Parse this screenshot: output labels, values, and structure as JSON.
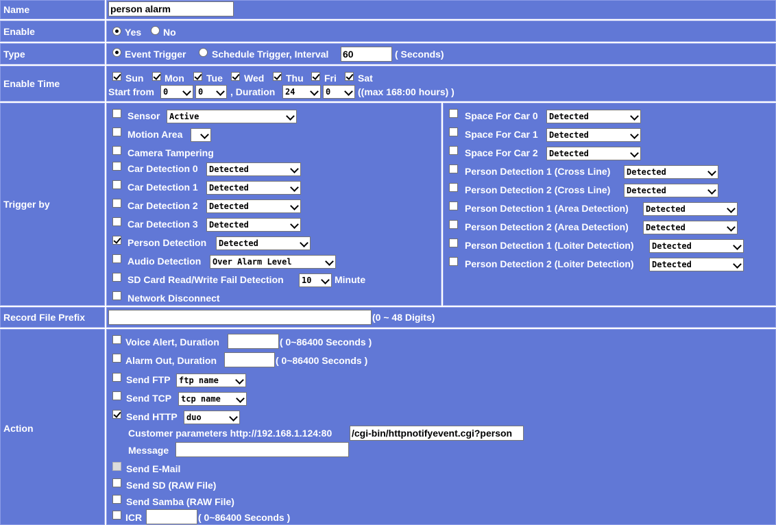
{
  "rows": {
    "name": {
      "label": "Name",
      "value": "person alarm"
    },
    "enable": {
      "label": "Enable",
      "yes": "Yes",
      "no": "No"
    },
    "type": {
      "label": "Type",
      "event": "Event Trigger",
      "schedule": "Schedule Trigger, Interval",
      "interval_value": "60",
      "unit": "( Seconds)"
    },
    "enable_time": {
      "label": "Enable Time",
      "days": [
        "Sun",
        "Mon",
        "Tue",
        "Wed",
        "Thu",
        "Fri",
        "Sat"
      ],
      "start_label": "Start from",
      "start_hour": "0",
      "start_min": "0",
      "duration_label": ", Duration",
      "dur_hour": "24",
      "dur_min": "0",
      "max_note": "((max 168:00 hours) )"
    },
    "trigger": {
      "label": "Trigger by",
      "sensor": {
        "label": "Sensor",
        "value": "Active"
      },
      "motion": {
        "label": "Motion Area",
        "value": ""
      },
      "tamper": {
        "label": "Camera Tampering"
      },
      "car0": {
        "label": "Car Detection 0",
        "value": "Detected"
      },
      "car1": {
        "label": "Car Detection 1",
        "value": "Detected"
      },
      "car2": {
        "label": "Car Detection 2",
        "value": "Detected"
      },
      "car3": {
        "label": "Car Detection 3",
        "value": "Detected"
      },
      "person": {
        "label": "Person Detection",
        "value": "Detected"
      },
      "audio": {
        "label": "Audio Detection",
        "value": "Over Alarm Level"
      },
      "sd": {
        "label": "SD Card Read/Write Fail Detection",
        "value": "10",
        "unit": "Minute"
      },
      "network": {
        "label": "Network Disconnect"
      },
      "space0": {
        "label": "Space For Car 0",
        "value": "Detected"
      },
      "space1": {
        "label": "Space For Car 1",
        "value": "Detected"
      },
      "space2": {
        "label": "Space For Car 2",
        "value": "Detected"
      },
      "pd1cross": {
        "label": "Person Detection 1 (Cross Line)",
        "value": "Detected"
      },
      "pd2cross": {
        "label": "Person Detection 2 (Cross Line)",
        "value": "Detected"
      },
      "pd1area": {
        "label": "Person Detection 1 (Area Detection)",
        "value": "Detected"
      },
      "pd2area": {
        "label": "Person Detection 2 (Area Detection)",
        "value": "Detected"
      },
      "pd1loiter": {
        "label": "Person Detection 1 (Loiter Detection)",
        "value": "Detected"
      },
      "pd2loiter": {
        "label": "Person Detection 2 (Loiter Detection)",
        "value": "Detected"
      }
    },
    "prefix": {
      "label": "Record File Prefix",
      "value": "",
      "hint": "(0 ~ 48 Digits)"
    },
    "action": {
      "label": "Action",
      "voice": {
        "label": "Voice Alert, Duration",
        "value": "",
        "hint": "( 0~86400 Seconds )"
      },
      "alarm": {
        "label": "Alarm Out, Duration",
        "value": "",
        "hint": "( 0~86400 Seconds )"
      },
      "ftp": {
        "label": "Send FTP",
        "value": "ftp name"
      },
      "tcp": {
        "label": "Send TCP",
        "value": "tcp name"
      },
      "http": {
        "label": "Send HTTP",
        "value": "duo"
      },
      "custom": {
        "label": "Customer parameters http://192.168.1.124:80",
        "value": "/cgi-bin/httpnotifyevent.cgi?person"
      },
      "message": {
        "label": "Message",
        "value": ""
      },
      "email": {
        "label": "Send E-Mail"
      },
      "sdraw": {
        "label": "Send SD  (RAW File)"
      },
      "samba": {
        "label": "Send Samba  (RAW File)"
      },
      "icr": {
        "label": "ICR",
        "value": "",
        "hint": "( 0~86400 Seconds )"
      }
    }
  },
  "colors": {
    "row_bg": "#6178d6",
    "border": "#8c9be6",
    "text": "#ffffff"
  }
}
